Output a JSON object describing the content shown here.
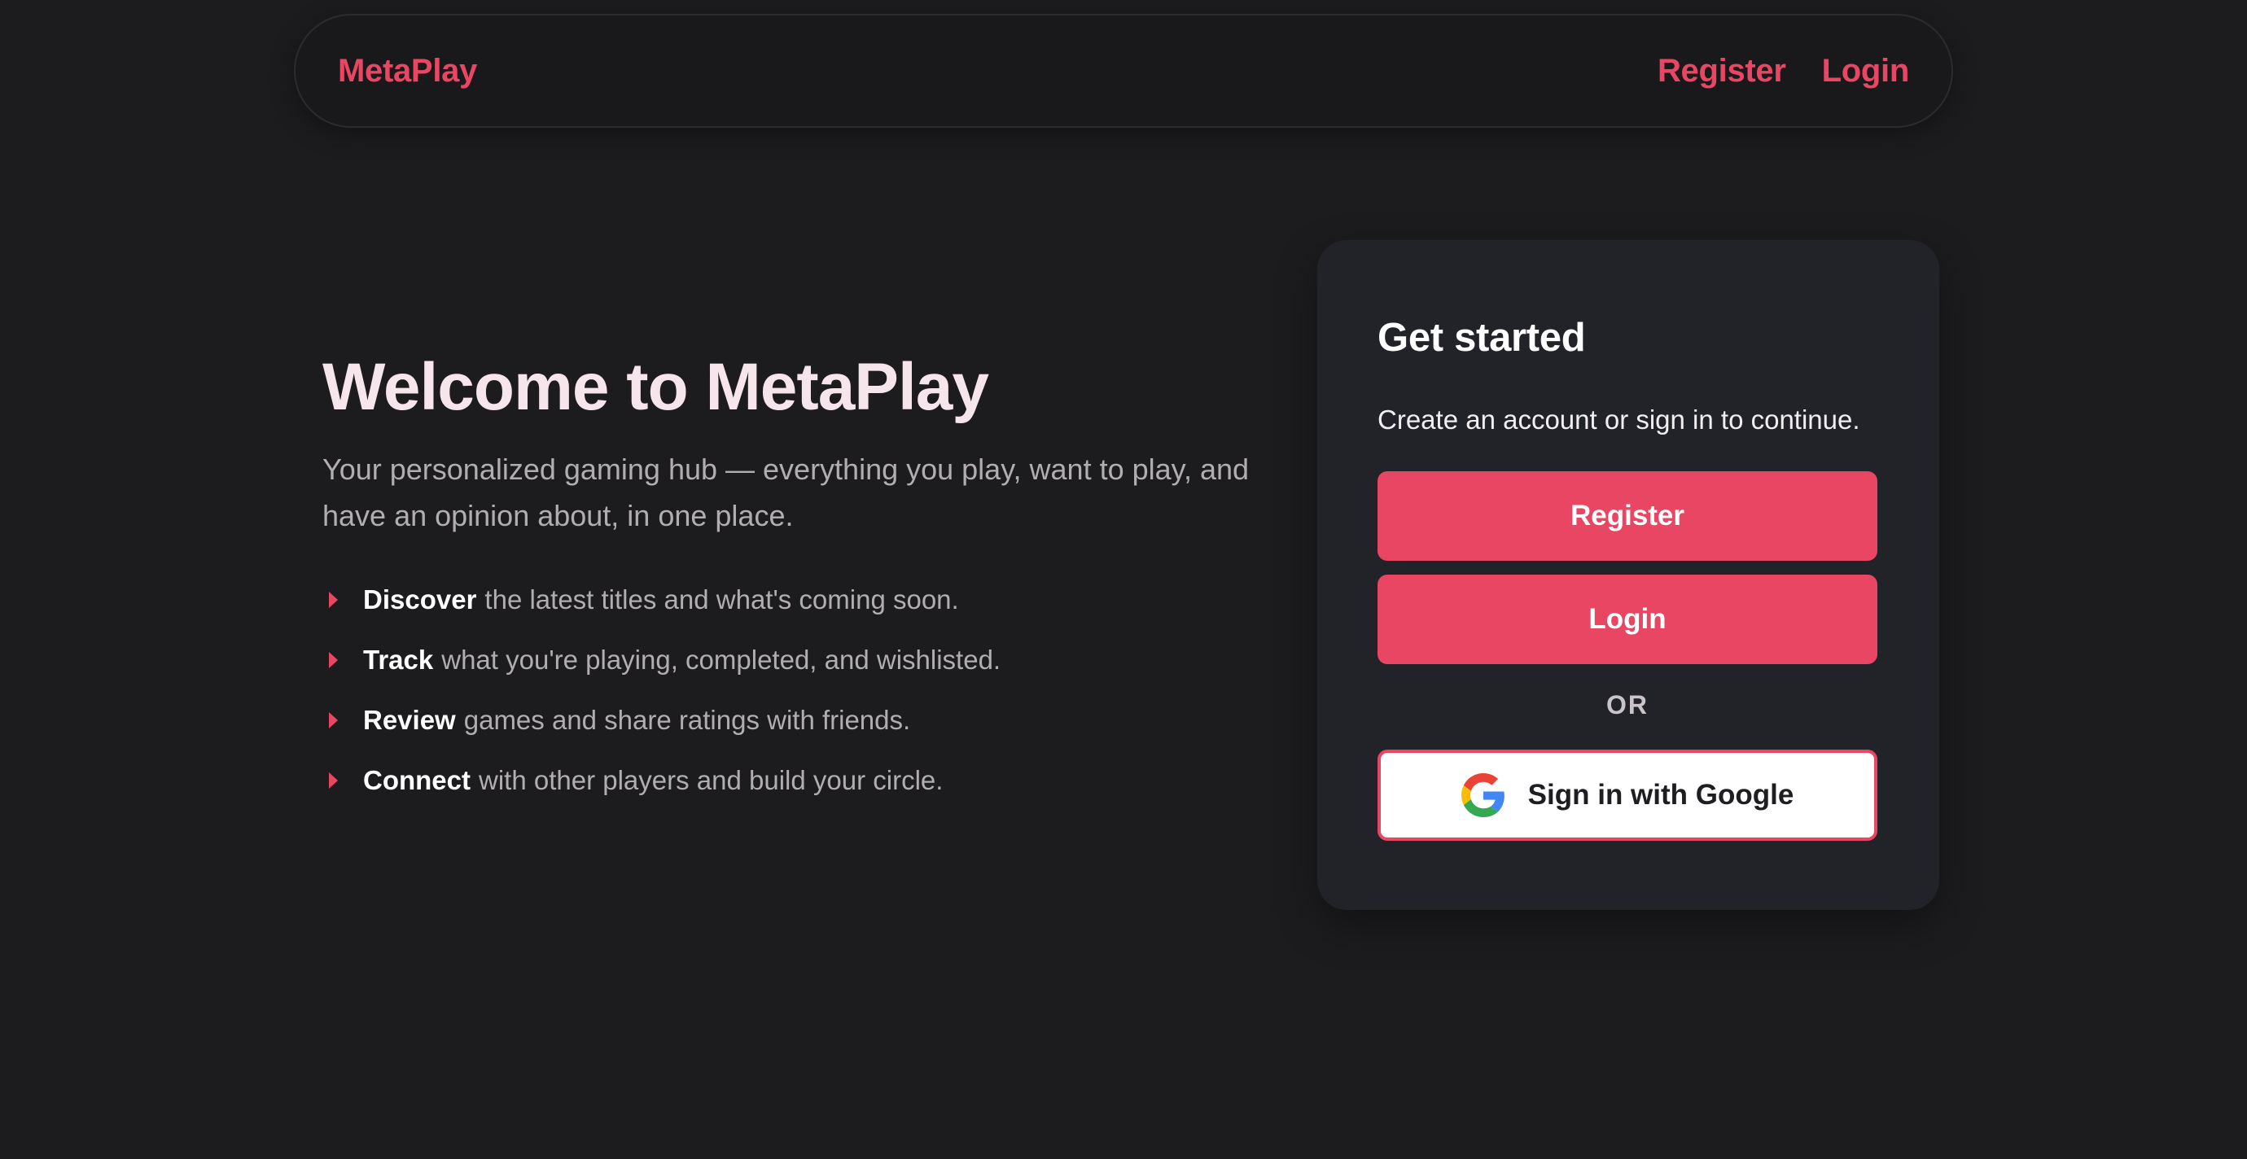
{
  "navbar": {
    "brand": "MetaPlay",
    "links": [
      {
        "label": "Register"
      },
      {
        "label": "Login"
      }
    ]
  },
  "hero": {
    "title": "Welcome to MetaPlay",
    "subtitle": "Your personalized gaming hub — everything you play, want to play, and have an opinion about, in one place.",
    "features": [
      {
        "strong": "Discover",
        "text": "the latest titles and what's coming soon."
      },
      {
        "strong": "Track",
        "text": "what you're playing, completed, and wishlisted."
      },
      {
        "strong": "Review",
        "text": "games and share ratings with friends."
      },
      {
        "strong": "Connect",
        "text": "with other players and build your circle."
      }
    ]
  },
  "card": {
    "title": "Get started",
    "description": "Create an account or sign in to continue.",
    "register_label": "Register",
    "login_label": "Login",
    "divider": "OR",
    "google_label": "Sign in with Google",
    "google_icon": "google-g-icon"
  },
  "colors": {
    "accent": "#e84663",
    "background": "#1c1c1e",
    "card_bg": "#222229",
    "heading": "#f6e5ea",
    "muted_text": "#b2adb0"
  }
}
